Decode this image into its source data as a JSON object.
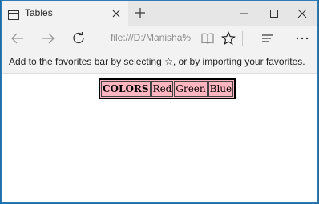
{
  "tab": {
    "title": "Tables"
  },
  "address_bar": {
    "url": "file:///D:/Manisha%"
  },
  "favorites_bar": {
    "message": "Add to the favorites bar by selecting ☆, or by importing your favorites."
  },
  "table": {
    "header": "COLORS",
    "cells": [
      "Red",
      "Green",
      "Blue"
    ],
    "background_color": "#ffb6c1"
  },
  "icons": {
    "tab": "tab-page-icon",
    "close_tab": "close-icon",
    "new_tab": "plus-icon",
    "back": "arrow-left-icon",
    "forward": "arrow-right-icon",
    "refresh": "refresh-icon",
    "reading_view": "book-icon",
    "favorite": "star-icon",
    "hub": "hub-lines-icon",
    "more": "ellipsis-icon"
  }
}
